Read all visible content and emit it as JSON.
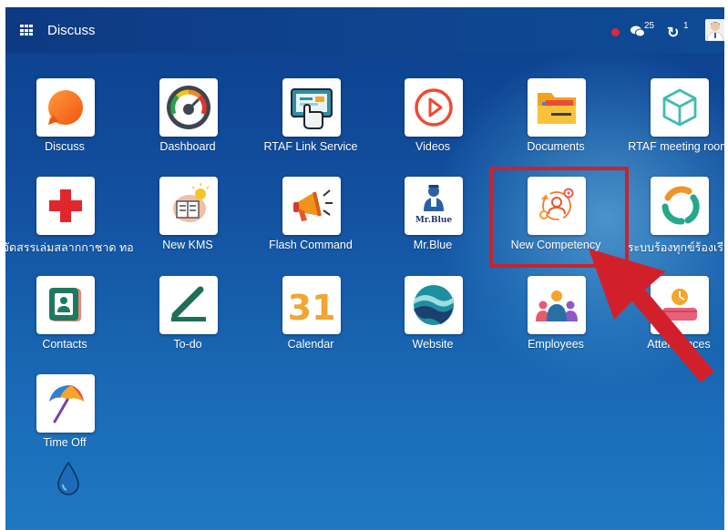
{
  "header": {
    "title": "Discuss",
    "message_count": "25",
    "activity_count": "1"
  },
  "apps": [
    {
      "label": "Discuss",
      "icon": "discuss-icon"
    },
    {
      "label": "Dashboard",
      "icon": "dashboard-gauge-icon"
    },
    {
      "label": "RTAF Link Service",
      "icon": "link-service-icon"
    },
    {
      "label": "Videos",
      "icon": "play-icon"
    },
    {
      "label": "Documents",
      "icon": "folder-icon"
    },
    {
      "label": "RTAF meeting room",
      "icon": "cube-icon"
    },
    {
      "label": "รจัดสรรเล่มสลากกาชาด ทอ.",
      "icon": "red-cross-icon"
    },
    {
      "label": "New KMS",
      "icon": "kms-icon"
    },
    {
      "label": "Flash Command",
      "icon": "megaphone-icon"
    },
    {
      "label": "Mr.Blue",
      "icon": "mr-blue-icon"
    },
    {
      "label": "New Competency",
      "icon": "competency-icon"
    },
    {
      "label": "ระบบร้องทุกข์ร้องเรีย",
      "icon": "complaint-icon"
    },
    {
      "label": "Contacts",
      "icon": "contact-card-icon"
    },
    {
      "label": "To-do",
      "icon": "todo-icon"
    },
    {
      "label": "Calendar",
      "icon": "calendar-icon"
    },
    {
      "label": "Website",
      "icon": "website-icon"
    },
    {
      "label": "Employees",
      "icon": "employees-icon"
    },
    {
      "label": "Attendances",
      "icon": "attendance-icon"
    },
    {
      "label": "Time Off",
      "icon": "umbrella-icon"
    }
  ],
  "calendar_icon_text": "31",
  "mrblue_icon_text": "Mr.Blue",
  "colors": {
    "accent_red": "#c8232e",
    "status_dot": "#e0263a",
    "topbar": "#0d3a82"
  }
}
